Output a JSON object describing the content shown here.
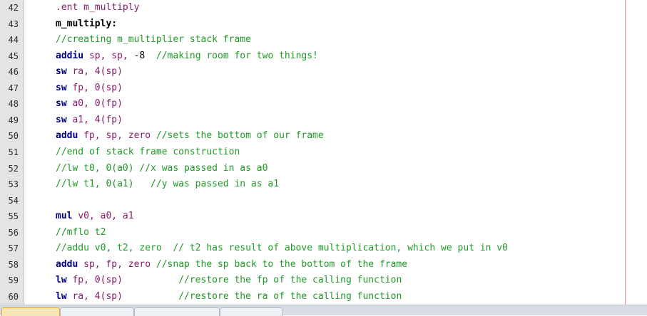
{
  "editor": {
    "lines": [
      {
        "n": "42",
        "segments": [
          {
            "t": ".ent ",
            "c": "c-dir"
          },
          {
            "t": "m_multiply",
            "c": "c-dir"
          }
        ]
      },
      {
        "n": "43",
        "segments": [
          {
            "t": "m_multiply:",
            "c": "c-lbl"
          }
        ]
      },
      {
        "n": "44",
        "segments": [
          {
            "t": "//creating m_multiplier stack frame",
            "c": "c-cmt"
          }
        ]
      },
      {
        "n": "45",
        "segments": [
          {
            "t": "addiu ",
            "c": "c-kw"
          },
          {
            "t": "sp, sp, ",
            "c": "c-reg"
          },
          {
            "t": "-8  ",
            "c": "c-plain"
          },
          {
            "t": "//making room for two things!",
            "c": "c-cmt"
          }
        ]
      },
      {
        "n": "46",
        "segments": [
          {
            "t": "sw ",
            "c": "c-kw"
          },
          {
            "t": "ra, 4(sp)",
            "c": "c-reg"
          }
        ]
      },
      {
        "n": "47",
        "segments": [
          {
            "t": "sw ",
            "c": "c-kw"
          },
          {
            "t": "fp, 0(sp)",
            "c": "c-reg"
          }
        ]
      },
      {
        "n": "48",
        "segments": [
          {
            "t": "sw ",
            "c": "c-kw"
          },
          {
            "t": "a0, 0(fp)",
            "c": "c-reg"
          }
        ]
      },
      {
        "n": "49",
        "segments": [
          {
            "t": "sw ",
            "c": "c-kw"
          },
          {
            "t": "a1, 4(fp)",
            "c": "c-reg"
          }
        ]
      },
      {
        "n": "50",
        "segments": [
          {
            "t": "addu ",
            "c": "c-kw"
          },
          {
            "t": "fp, sp, zero ",
            "c": "c-reg"
          },
          {
            "t": "//sets the bottom of our frame",
            "c": "c-cmt"
          }
        ]
      },
      {
        "n": "51",
        "segments": [
          {
            "t": "//end of stack frame construction",
            "c": "c-cmt"
          }
        ]
      },
      {
        "n": "52",
        "segments": [
          {
            "t": "//lw t0, 0(a0) //x was passed in as a0",
            "c": "c-cmt"
          }
        ]
      },
      {
        "n": "53",
        "segments": [
          {
            "t": "//lw t1, 0(a1)   //y was passed in as a1",
            "c": "c-cmt"
          }
        ]
      },
      {
        "n": "54",
        "segments": []
      },
      {
        "n": "55",
        "segments": [
          {
            "t": "mul ",
            "c": "c-kw"
          },
          {
            "t": "v0, a0, a1",
            "c": "c-reg"
          }
        ]
      },
      {
        "n": "56",
        "segments": [
          {
            "t": "//mflo t2",
            "c": "c-cmt"
          }
        ]
      },
      {
        "n": "57",
        "segments": [
          {
            "t": "//addu v0, t2, zero  // t2 has result of above multiplication, which we put in v0",
            "c": "c-cmt"
          }
        ]
      },
      {
        "n": "58",
        "segments": [
          {
            "t": "addu ",
            "c": "c-kw"
          },
          {
            "t": "sp, fp, zero ",
            "c": "c-reg"
          },
          {
            "t": "//snap the sp back to the bottom of the frame",
            "c": "c-cmt"
          }
        ]
      },
      {
        "n": "59",
        "segments": [
          {
            "t": "lw ",
            "c": "c-kw"
          },
          {
            "t": "fp, 0(sp)          ",
            "c": "c-reg"
          },
          {
            "t": "//restore the fp of the calling function",
            "c": "c-cmt"
          }
        ]
      },
      {
        "n": "60",
        "segments": [
          {
            "t": "lw ",
            "c": "c-kw"
          },
          {
            "t": "ra, 4(sp)          ",
            "c": "c-reg"
          },
          {
            "t": "//restore the ra of the calling function",
            "c": "c-cmt"
          }
        ]
      }
    ]
  },
  "colors": {
    "gutter_bg": "#e4e4e4",
    "comment": "#1f9a26",
    "keyword": "#000080",
    "register": "#8b1a6b",
    "margin_line": "#f08a8a",
    "active_tab": "#f7e7b8"
  },
  "tabs": [
    {
      "label": "",
      "active": true
    },
    {
      "label": "",
      "active": false
    },
    {
      "label": "",
      "active": false
    },
    {
      "label": "",
      "active": false
    }
  ]
}
